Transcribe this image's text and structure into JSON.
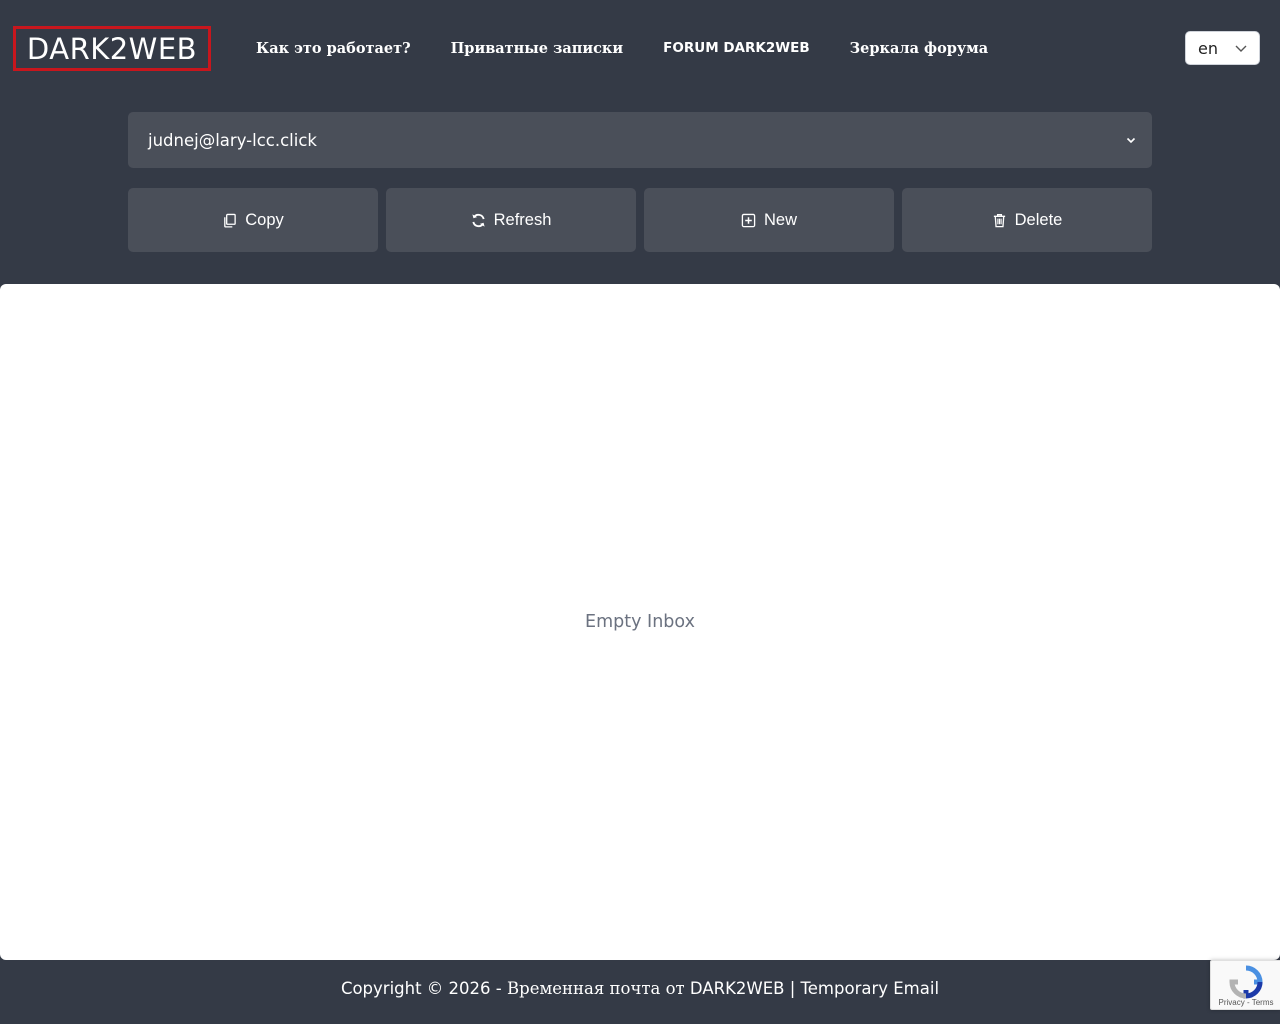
{
  "header": {
    "logo": "DARK2WEB",
    "nav": [
      {
        "label": "Как это работает?"
      },
      {
        "label": "Приватные записки"
      },
      {
        "label": "FORUM DARK2WEB"
      },
      {
        "label": "Зеркала форума"
      }
    ],
    "language": {
      "selected": "en"
    }
  },
  "email": {
    "current": "judnej@lary-lcc.click"
  },
  "actions": {
    "copy": {
      "label": "Copy",
      "icon": "copy-icon"
    },
    "refresh": {
      "label": "Refresh",
      "icon": "refresh-icon"
    },
    "new": {
      "label": "New",
      "icon": "plus-square-icon"
    },
    "delete": {
      "label": "Delete",
      "icon": "trash-icon"
    }
  },
  "inbox": {
    "empty_text": "Empty Inbox"
  },
  "footer": {
    "prefix": "Copyright © 2026 - ",
    "ru": "Временная почта от ",
    "suffix": "DARK2WEB | Temporary Email"
  },
  "recaptcha": {
    "links": "Privacy - Terms"
  },
  "colors": {
    "background": "#343a46",
    "control": "#4a4f59",
    "logo_border": "#c8161d",
    "inbox_bg": "#ffffff",
    "muted_text": "#6b7280"
  }
}
